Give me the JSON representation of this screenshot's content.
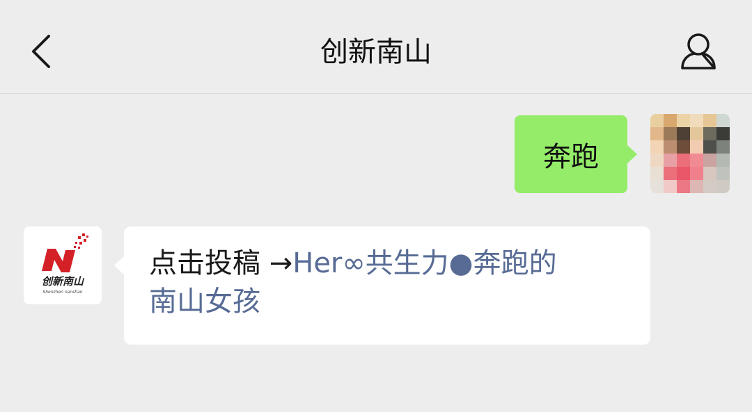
{
  "header": {
    "title": "创新南山",
    "back_icon": "chevron-left-icon",
    "profile_icon": "person-icon"
  },
  "messages": [
    {
      "sender": "self",
      "text": "奔跑",
      "bubble_color": "#95ec69"
    },
    {
      "sender": "official",
      "prefix": "点击投稿 →",
      "link_text_line1": "Her∞共生力●奔跑的",
      "link_text_line2": "南山女孩",
      "link_color": "#576b95"
    }
  ],
  "official_avatar": {
    "brand": "创新南山",
    "sub": "Shenzhen nanshan",
    "brand_color": "#d42027"
  }
}
